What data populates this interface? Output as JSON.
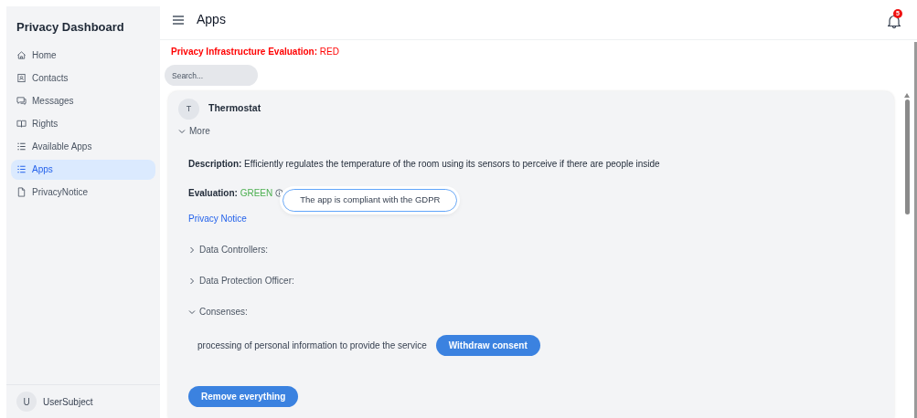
{
  "sidebar": {
    "title": "Privacy Dashboard",
    "items": [
      {
        "label": "Home",
        "selected": false
      },
      {
        "label": "Contacts",
        "selected": false
      },
      {
        "label": "Messages",
        "selected": false
      },
      {
        "label": "Rights",
        "selected": false
      },
      {
        "label": "Available Apps",
        "selected": false
      },
      {
        "label": "Apps",
        "selected": true
      },
      {
        "label": "PrivacyNotice",
        "selected": false
      }
    ],
    "user": {
      "initial": "U",
      "name": "UserSubject"
    }
  },
  "header": {
    "title": "Apps",
    "notification_count": "5"
  },
  "evaluation_banner": {
    "label": "Privacy Infrastructure Evaluation:",
    "value": "RED"
  },
  "search": {
    "placeholder": "Search..."
  },
  "app": {
    "initial": "T",
    "name": "Thermostat",
    "more": {
      "label": "More",
      "expanded": true
    },
    "description": {
      "label": "Description:",
      "text": "Efficiently regulates the temperature of the room using its sensors to perceive if there are people inside"
    },
    "evaluation": {
      "label": "Evaluation:",
      "value": "GREEN",
      "tooltip": "The app is compliant with the GDPR"
    },
    "privacy_notice_link": "Privacy Notice",
    "sections": [
      {
        "label": "Data Controllers:",
        "expanded": false
      },
      {
        "label": "Data Protection Officer:",
        "expanded": false
      },
      {
        "label": "Consenses:",
        "expanded": true,
        "consents": [
          {
            "text": "processing of personal information to provide the service",
            "button": "Withdraw consent"
          }
        ]
      }
    ],
    "remove_button": "Remove everything"
  }
}
